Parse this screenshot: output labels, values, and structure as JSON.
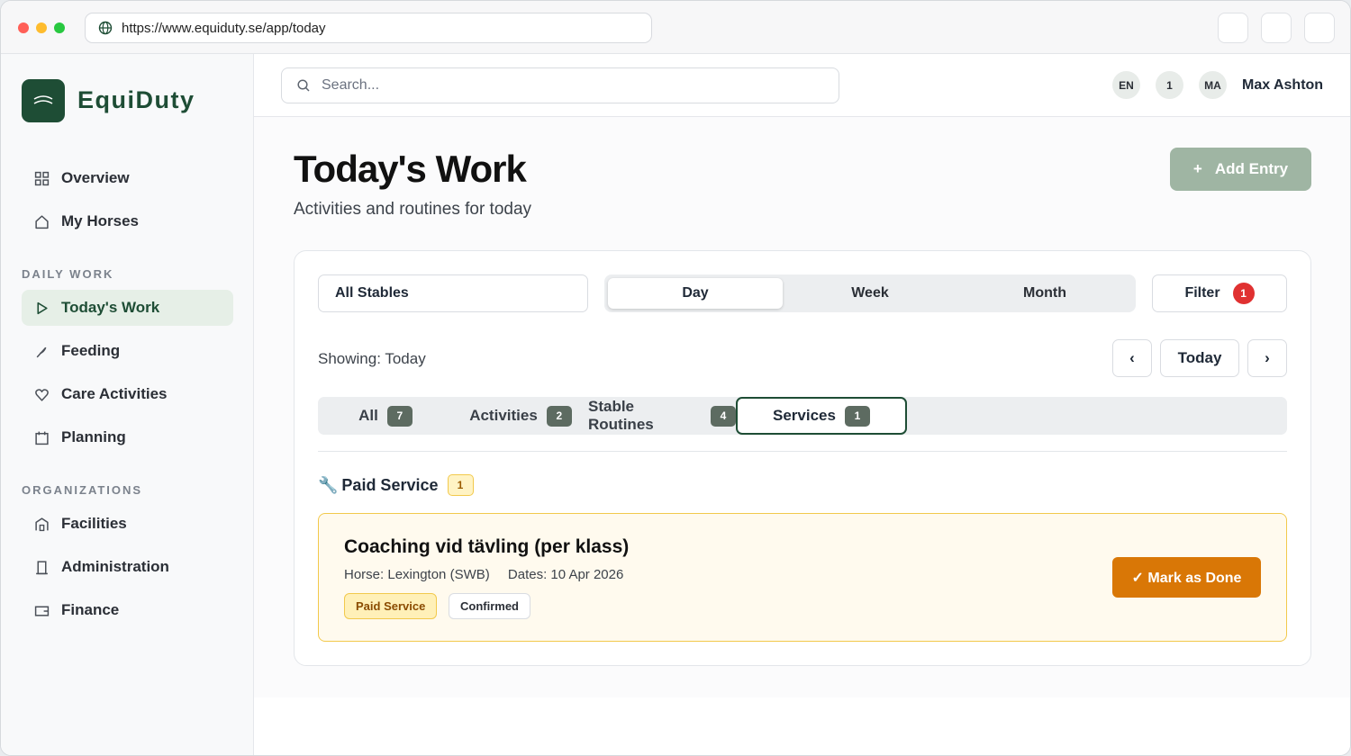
{
  "browser": {
    "url": "https://www.equiduty.se/app/today"
  },
  "brand": {
    "name": "EquiDuty",
    "color": "#1e4d35"
  },
  "sidebar": {
    "items": [
      {
        "label": "Overview",
        "icon": "grid-icon"
      },
      {
        "label": "My Horses",
        "icon": "home-icon"
      }
    ],
    "daily_work_heading": "DAILY WORK",
    "daily_work": [
      {
        "label": "Today's Work",
        "icon": "play-icon",
        "active": true
      },
      {
        "label": "Feeding",
        "icon": "feather-icon"
      },
      {
        "label": "Care Activities",
        "icon": "heart-icon"
      },
      {
        "label": "Planning",
        "icon": "calendar-icon"
      }
    ],
    "organizations_heading": "ORGANIZATIONS",
    "organizations": [
      {
        "label": "Facilities",
        "icon": "building-icon"
      },
      {
        "label": "Administration",
        "icon": "door-icon"
      },
      {
        "label": "Finance",
        "icon": "wallet-icon"
      }
    ]
  },
  "header": {
    "search_placeholder": "Search...",
    "language": "EN",
    "notifications_count": "1",
    "avatar_initials": "MA",
    "user_name": "Max Ashton"
  },
  "page": {
    "title": "Today's Work",
    "subtitle": "Activities and routines for today",
    "add_button": "Add Entry",
    "add_button_plus": "+"
  },
  "filters": {
    "stable_select": "All Stables",
    "views": [
      "Day",
      "Week",
      "Month"
    ],
    "active_view": "Day",
    "filter_label": "Filter",
    "filter_count": "1",
    "showing": "Showing: Today",
    "prev": "‹",
    "today": "Today",
    "next": "›"
  },
  "tabs": [
    {
      "label": "All",
      "count": "7"
    },
    {
      "label": "Activities",
      "count": "2"
    },
    {
      "label": "Stable Routines",
      "count": "4"
    },
    {
      "label": "Services",
      "count": "1",
      "active": true
    }
  ],
  "group": {
    "icon": "🔧",
    "title": "Paid Service",
    "count": "1"
  },
  "entry": {
    "title": "Coaching vid tävling (per klass)",
    "horse": "Horse: Lexington (SWB)",
    "dates": "Dates: 10 Apr 2026",
    "tag_type": "Paid Service",
    "tag_status": "Confirmed",
    "action": "✓ Mark as Done",
    "accent": "#d97706"
  }
}
